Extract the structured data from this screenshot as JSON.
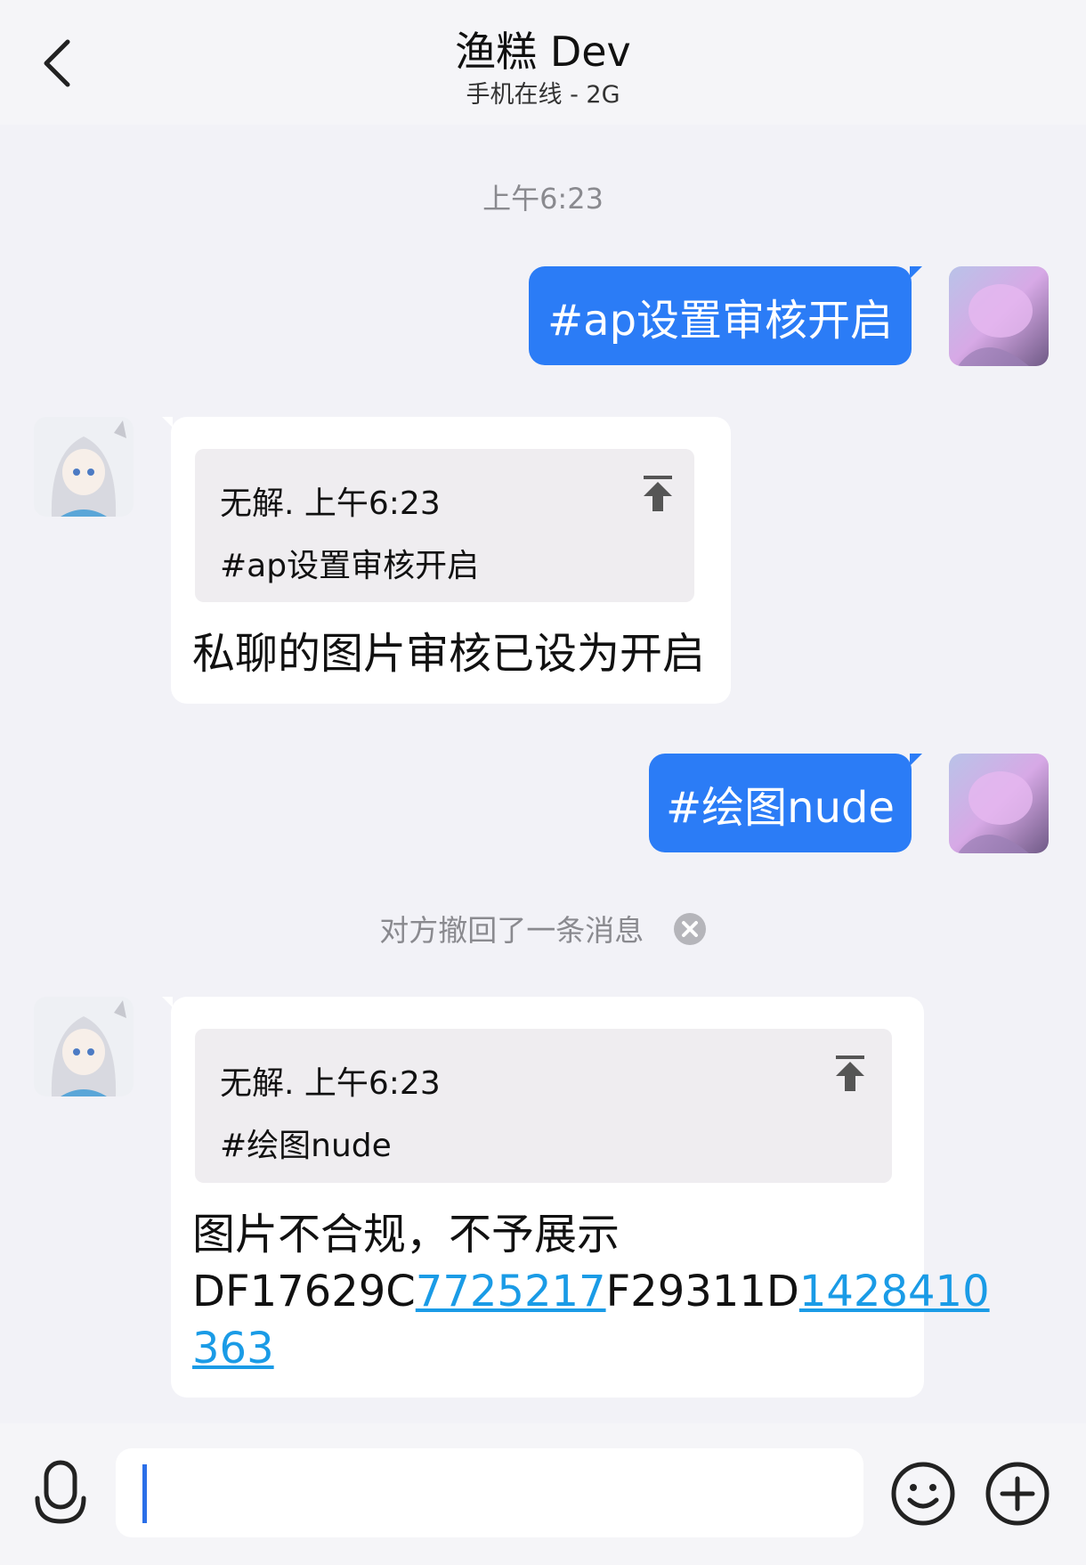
{
  "header": {
    "title": "渔糕 Dev",
    "status": "手机在线 - 2G"
  },
  "timestamp": "上午6:23",
  "messages": [
    {
      "type": "sent",
      "text": "#ap设置审核开启"
    },
    {
      "type": "received",
      "quote": {
        "meta": "无解. 上午6:23",
        "text": "#ap设置审核开启"
      },
      "reply": "私聊的图片审核已设为开启"
    },
    {
      "type": "sent",
      "text": "#绘图nude"
    },
    {
      "type": "recall",
      "text": "对方撤回了一条消息"
    },
    {
      "type": "received",
      "quote": {
        "meta": "无解. 上午6:23",
        "text": "#绘图nude"
      },
      "reply_line1": "图片不合规，不予展示",
      "reply_code": [
        "DF17629C",
        "7725217",
        "F29311D",
        "1428410",
        "363"
      ]
    }
  ],
  "input": {
    "value": "",
    "placeholder": ""
  },
  "icons": {
    "back": "chevron-left-icon",
    "quote": "scroll-to-top-icon",
    "recall_close": "close-circle-icon",
    "mic": "microphone-icon",
    "emoji": "smiley-icon",
    "plus": "plus-circle-icon"
  },
  "colors": {
    "sent_bubble": "#2b7cf6",
    "link": "#1a9be6",
    "background": "#f2f2f7"
  }
}
